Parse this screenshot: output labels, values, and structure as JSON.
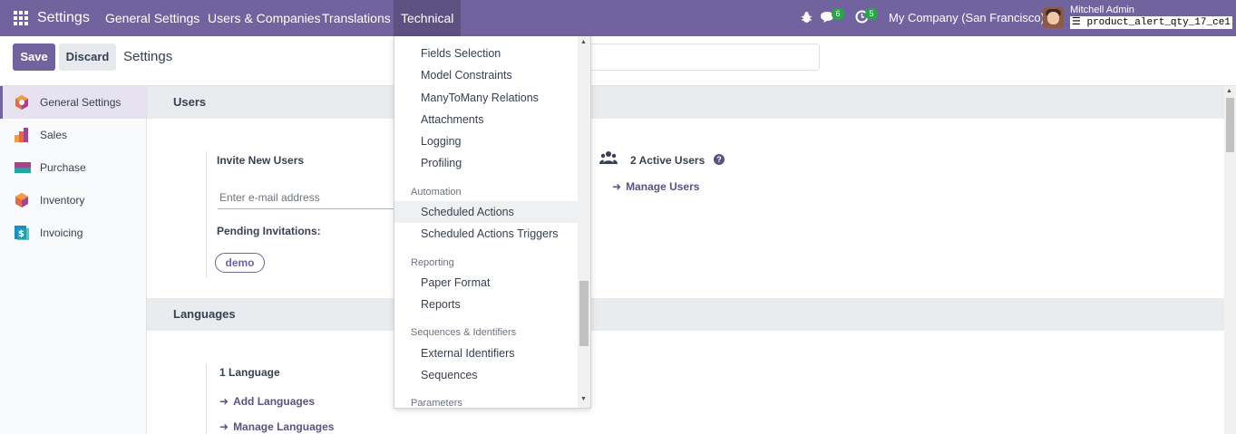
{
  "navbar": {
    "brand": "Settings",
    "menus": [
      "General Settings",
      "Users & Companies",
      "Translations",
      "Technical"
    ],
    "chat_count": "6",
    "activity_count": "5",
    "company": "My Company (San Francisco)",
    "user_name": "Mitchell Admin",
    "database": "product_alert_qty_17_ce1"
  },
  "control_panel": {
    "save_label": "Save",
    "discard_label": "Discard",
    "title": "Settings"
  },
  "sidebar": {
    "items": [
      {
        "label": "General Settings",
        "icon": "settings-app-icon"
      },
      {
        "label": "Sales",
        "icon": "sales-app-icon"
      },
      {
        "label": "Purchase",
        "icon": "purchase-app-icon"
      },
      {
        "label": "Inventory",
        "icon": "inventory-app-icon"
      },
      {
        "label": "Invoicing",
        "icon": "invoicing-app-icon"
      }
    ]
  },
  "users_section": {
    "header": "Users",
    "invite_title": "Invite New Users",
    "email_placeholder": "Enter e-mail address",
    "pending_title": "Pending Invitations:",
    "pending_user": "demo",
    "active_users": "2 Active Users",
    "manage_users": "Manage Users"
  },
  "languages_section": {
    "header": "Languages",
    "count": "1 Language",
    "add_link": "Add Languages",
    "manage_link": "Manage Languages"
  },
  "dropdown": {
    "items_group1": [
      "Fields Selection",
      "Model Constraints",
      "ManyToMany Relations",
      "Attachments",
      "Logging",
      "Profiling"
    ],
    "automation_header": "Automation",
    "automation_items": [
      "Scheduled Actions",
      "Scheduled Actions Triggers"
    ],
    "reporting_header": "Reporting",
    "reporting_items": [
      "Paper Format",
      "Reports"
    ],
    "sequences_header": "Sequences & Identifiers",
    "sequences_items": [
      "External Identifiers",
      "Sequences"
    ],
    "parameters_header": "Parameters"
  },
  "colors": {
    "brand": "#71639e",
    "badge": "#28a745"
  }
}
